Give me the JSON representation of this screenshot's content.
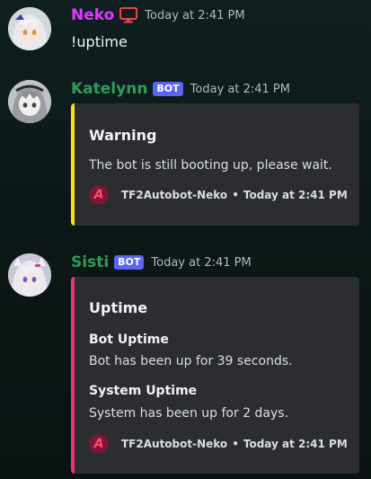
{
  "colors": {
    "neko": "#e23bff",
    "katelynn": "#2e9d5a",
    "sisti": "#2e9d5a",
    "warning_bar": "#f7e21b",
    "uptime_bar": "#e9347f",
    "bot_tag": "#5865f2",
    "monitor_icon": "#ed4245"
  },
  "messages": [
    {
      "username": "Neko",
      "icon": "monitor-icon",
      "timestamp": "Today at 2:41 PM",
      "content": "!uptime"
    },
    {
      "username": "Katelynn",
      "bot_tag": "BOT",
      "timestamp": "Today at 2:41 PM",
      "embed": {
        "title": "Warning",
        "description": "The bot is still booting up, please wait.",
        "footer_icon": "A",
        "footer_name": "TF2Autobot-Neko",
        "footer_sep": "•",
        "footer_time": "Today at 2:41 PM"
      }
    },
    {
      "username": "Sisti",
      "bot_tag": "BOT",
      "timestamp": "Today at 2:41 PM",
      "embed": {
        "title": "Uptime",
        "fields": [
          {
            "name": "Bot Uptime",
            "value": "Bot has been up for 39 seconds."
          },
          {
            "name": "System Uptime",
            "value": "System has been up for 2 days."
          }
        ],
        "footer_icon": "A",
        "footer_name": "TF2Autobot-Neko",
        "footer_sep": "•",
        "footer_time": "Today at 2:41 PM"
      }
    }
  ]
}
